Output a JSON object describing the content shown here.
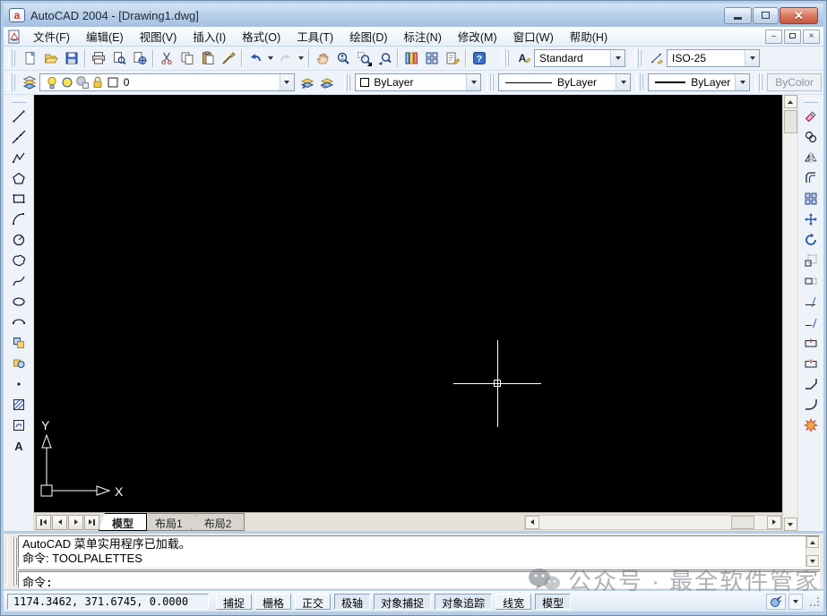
{
  "window": {
    "title": "AutoCAD 2004 - [Drawing1.dwg]"
  },
  "menu": {
    "items": [
      {
        "label": "文件(F)",
        "key": "file"
      },
      {
        "label": "编辑(E)",
        "key": "edit"
      },
      {
        "label": "视图(V)",
        "key": "view"
      },
      {
        "label": "插入(I)",
        "key": "insert"
      },
      {
        "label": "格式(O)",
        "key": "format"
      },
      {
        "label": "工具(T)",
        "key": "tools"
      },
      {
        "label": "绘图(D)",
        "key": "draw"
      },
      {
        "label": "标注(N)",
        "key": "dimension"
      },
      {
        "label": "修改(M)",
        "key": "modify"
      },
      {
        "label": "窗口(W)",
        "key": "window"
      },
      {
        "label": "帮助(H)",
        "key": "help"
      }
    ]
  },
  "toolbars": {
    "standard": [
      {
        "icon": "new"
      },
      {
        "icon": "open"
      },
      {
        "icon": "save"
      },
      {
        "sep": true
      },
      {
        "icon": "print"
      },
      {
        "icon": "print-preview"
      },
      {
        "icon": "publish"
      },
      {
        "sep": true
      },
      {
        "icon": "cut"
      },
      {
        "icon": "copy-clip"
      },
      {
        "icon": "paste"
      },
      {
        "icon": "match-properties"
      },
      {
        "sep": true
      },
      {
        "icon": "undo",
        "arrow": true
      },
      {
        "icon": "redo",
        "arrow": true,
        "disabled": true
      },
      {
        "sep": true
      },
      {
        "icon": "pan"
      },
      {
        "icon": "zoom-realtime"
      },
      {
        "icon": "zoom-window",
        "flyout": true
      },
      {
        "icon": "zoom-previous"
      },
      {
        "sep": true
      },
      {
        "icon": "properties"
      },
      {
        "icon": "designcenter"
      },
      {
        "icon": "tool-palettes"
      },
      {
        "sep": true
      },
      {
        "icon": "help"
      }
    ],
    "styles": {
      "text_style_value": "Standard",
      "dim_style_value": "ISO-25"
    },
    "layers": {
      "current_layer": "0",
      "state_icons": [
        "bulb",
        "sun",
        "freeze-viewport",
        "lock",
        "color-swatch"
      ]
    },
    "properties": {
      "color_value": "ByLayer",
      "linetype_value": "ByLayer",
      "lineweight_value": "ByLayer",
      "plot_style_value": "ByColor"
    },
    "draw": [
      "line",
      "construction-line",
      "polyline",
      "polygon",
      "rectangle",
      "arc",
      "circle",
      "revision-cloud",
      "spline",
      "ellipse",
      "ellipse-arc",
      "insert-block",
      "make-block",
      "point",
      "hatch",
      "region",
      "multiline-text"
    ],
    "modify": [
      "erase",
      "copy-object",
      "mirror",
      "offset",
      "array",
      "move",
      "rotate",
      "scale",
      "stretch",
      "trim",
      "extend",
      "break-at-point",
      "break",
      "chamfer",
      "fillet",
      "explode"
    ]
  },
  "canvas": {
    "ucs_x_label": "X",
    "ucs_y_label": "Y"
  },
  "layout_tabs": [
    {
      "label": "模型",
      "key": "model",
      "active": true
    },
    {
      "label": "布局1",
      "key": "layout1",
      "active": false
    },
    {
      "label": "布局2",
      "key": "layout2",
      "active": false
    }
  ],
  "command": {
    "history": [
      "AutoCAD 菜单实用程序已加载。",
      "命令: TOOLPALETTES"
    ],
    "prompt": "命令:"
  },
  "status": {
    "coordinates": "1174.3462, 371.6745, 0.0000",
    "toggles": [
      {
        "label": "捕捉",
        "key": "snap",
        "pressed": false
      },
      {
        "label": "栅格",
        "key": "grid",
        "pressed": false
      },
      {
        "label": "正交",
        "key": "ortho",
        "pressed": false
      },
      {
        "label": "极轴",
        "key": "polar",
        "pressed": true
      },
      {
        "label": "对象捕捉",
        "key": "osnap",
        "pressed": true
      },
      {
        "label": "对象追踪",
        "key": "otrack",
        "pressed": true
      },
      {
        "label": "线宽",
        "key": "lineweight",
        "pressed": false
      },
      {
        "label": "模型",
        "key": "model-space",
        "pressed": true
      }
    ]
  },
  "watermark": {
    "text": "公众号 · 最全软件管家"
  },
  "colors": {
    "frame": "#b7cde6",
    "close_button": "#c8563f",
    "canvas": "#000000",
    "toolbar_bg": "#eef3fa"
  }
}
